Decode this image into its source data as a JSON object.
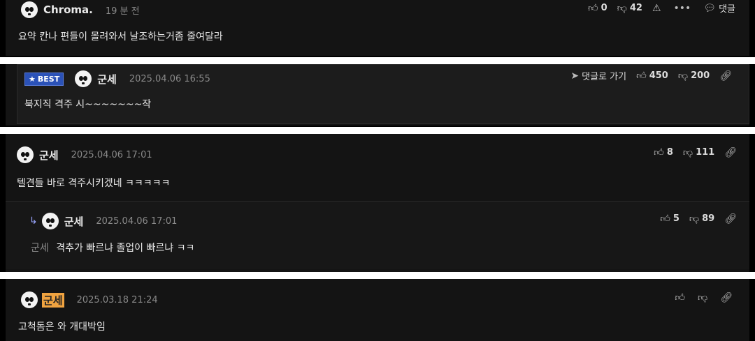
{
  "comments": [
    {
      "user": "Chroma.",
      "time": "19 분 전",
      "text": "요약 칸나 편들이 몰려와서 날조하는거좀 줄여달라",
      "likes": "0",
      "dislikes": "42",
      "reply_label": "댓글"
    },
    {
      "badge": "BEST",
      "user": "군세",
      "time": "2025.04.06 16:55",
      "text": "북지직 격주 시~~~~~~~작",
      "goto_label": "댓글로 가기",
      "likes": "450",
      "dislikes": "200"
    },
    {
      "user": "군세",
      "time": "2025.04.06 17:01",
      "text": "텔견들 바로 격주시키겠네 ㅋㅋㅋㅋㅋ",
      "likes": "8",
      "dislikes": "111"
    },
    {
      "user": "군세",
      "time": "2025.04.06 17:01",
      "mention": "군세",
      "text": "격추가 빠르냐 졸업이 빠르냐 ㅋㅋ",
      "likes": "5",
      "dislikes": "89"
    },
    {
      "user": "군세",
      "time": "2025.03.18 21:24",
      "text": "고척돔은 와 개대박임",
      "likes": "",
      "dislikes": ""
    }
  ],
  "icons": {
    "like": "thumbs-up-icon",
    "dislike": "thumbs-down-icon",
    "report": "warning-icon",
    "more": "more-icon",
    "comment": "comment-icon",
    "link": "link-icon",
    "reply": "reply-arrow-icon",
    "goto": "send-icon"
  }
}
